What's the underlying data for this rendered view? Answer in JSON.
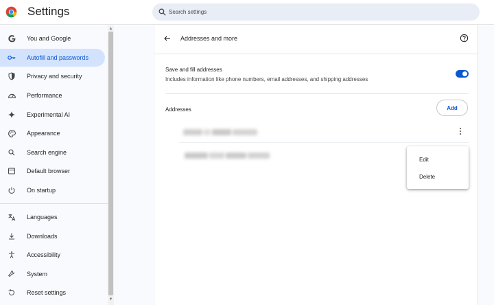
{
  "app": {
    "title": "Settings",
    "logo_icon": "chrome-logo-icon"
  },
  "search": {
    "placeholder": "Search settings",
    "icon": "search-icon"
  },
  "sidebar": {
    "items": [
      {
        "label": "You and Google",
        "icon": "google-g-icon",
        "active": false
      },
      {
        "label": "Autofill and passwords",
        "icon": "key-icon",
        "active": true
      },
      {
        "label": "Privacy and security",
        "icon": "shield-icon",
        "active": false
      },
      {
        "label": "Performance",
        "icon": "speedometer-icon",
        "active": false
      },
      {
        "label": "Experimental AI",
        "icon": "sparkle-icon",
        "active": false
      },
      {
        "label": "Appearance",
        "icon": "palette-icon",
        "active": false
      },
      {
        "label": "Search engine",
        "icon": "search-icon",
        "active": false
      },
      {
        "label": "Default browser",
        "icon": "browser-window-icon",
        "active": false
      },
      {
        "label": "On startup",
        "icon": "power-icon",
        "active": false
      },
      {
        "label": "Languages",
        "icon": "translate-icon",
        "active": false
      },
      {
        "label": "Downloads",
        "icon": "download-icon",
        "active": false
      },
      {
        "label": "Accessibility",
        "icon": "accessibility-icon",
        "active": false
      },
      {
        "label": "System",
        "icon": "wrench-icon",
        "active": false
      },
      {
        "label": "Reset settings",
        "icon": "reset-icon",
        "active": false
      }
    ]
  },
  "page": {
    "title": "Addresses and more",
    "back_icon": "back-arrow-icon",
    "help_icon": "help-circle-icon"
  },
  "save_fill": {
    "title": "Save and fill addresses",
    "description": "Includes information like phone numbers, email addresses, and shipping addresses",
    "enabled": true
  },
  "addresses": {
    "heading": "Addresses",
    "add_label": "Add"
  },
  "context_menu": {
    "items": [
      "Edit",
      "Delete"
    ]
  },
  "colors": {
    "accent": "#0b57d0",
    "active_nav_bg": "#d3e3fd",
    "search_bg": "#e9eef6"
  }
}
